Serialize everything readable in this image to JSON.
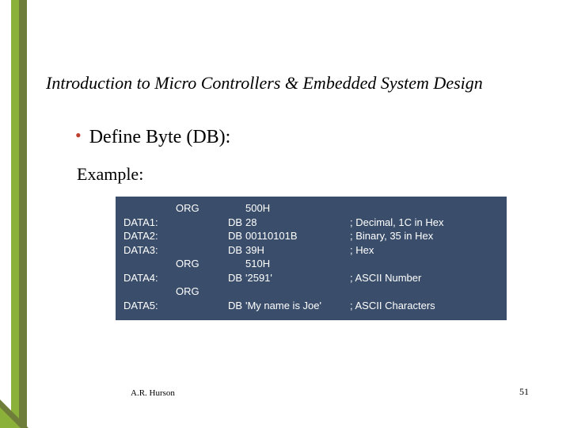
{
  "title": "Introduction to Micro Controllers & Embedded System Design",
  "bullet": "Define Byte (DB):",
  "example_label": "Example:",
  "code": {
    "r1": {
      "label": "",
      "org": "ORG",
      "db": "",
      "val": "500H",
      "cmt": ""
    },
    "r2": {
      "label": "DATA1:",
      "org": "",
      "db": "DB",
      "val": "28",
      "cmt": "; Decimal, 1C in Hex"
    },
    "r3": {
      "label": "DATA2:",
      "org": "",
      "db": "DB",
      "val": "00110101B",
      "cmt": "; Binary, 35 in Hex"
    },
    "r4": {
      "label": "DATA3:",
      "org": "",
      "db": "DB",
      "val": "39H",
      "cmt": "; Hex"
    },
    "r5": {
      "label": "",
      "org": "ORG",
      "db": "",
      "val": "510H",
      "cmt": ""
    },
    "r6": {
      "label": "DATA4:",
      "org": "",
      "db": "DB",
      "val": "'2591'",
      "cmt": "; ASCII Number"
    },
    "r7": {
      "label": "",
      "org": "ORG",
      "db": "",
      "val": "",
      "cmt": ""
    },
    "r8": {
      "label": "DATA5:",
      "org": "",
      "db": "DB",
      "val": "'My name is Joe'",
      "cmt": "; ASCII Characters"
    }
  },
  "footer_author": "A.R. Hurson",
  "footer_page": "51"
}
